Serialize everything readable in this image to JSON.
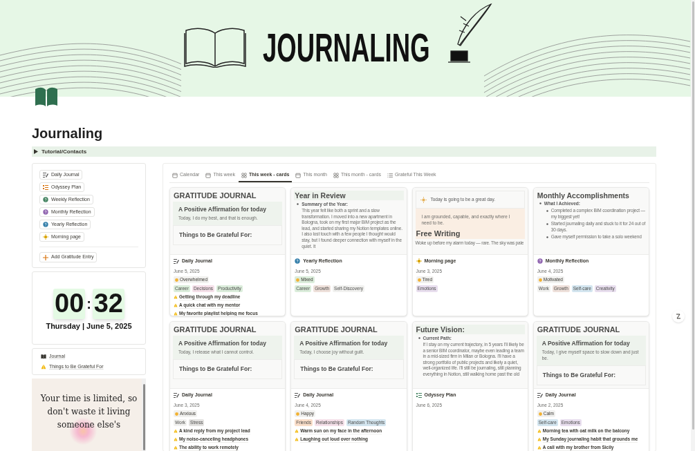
{
  "banner": {
    "title": "JOURNALING"
  },
  "page": {
    "title": "Journaling"
  },
  "toggle": {
    "label": "Tutorial/Contacts",
    "expanded": false
  },
  "buttons": [
    {
      "label": "Daily Journal",
      "kind": "journal",
      "color": "#555555"
    },
    {
      "label": "Odyssey Plan",
      "kind": "checklist",
      "color": "#d9730d"
    },
    {
      "label": "Weekly Reflection",
      "kind": "question",
      "color": "#448361"
    },
    {
      "label": "Monthly Reflection",
      "kind": "question",
      "color": "#9065b0"
    },
    {
      "label": "Yearly Reflection",
      "kind": "question",
      "color": "#337ea9"
    },
    {
      "label": "Morning page",
      "kind": "sun",
      "color": "#d9a400"
    }
  ],
  "add_button": {
    "label": "Add Gratitude Entry"
  },
  "clock": {
    "hours": "00",
    "separator": ":",
    "minutes": "32",
    "date": "Thursday | June 5, 2025"
  },
  "links": [
    {
      "label": "Journal",
      "kind": "book"
    },
    {
      "label": "Things to Be Grateful For",
      "kind": "hands"
    }
  ],
  "quote": {
    "text": "Your time is limited, so don't waste it living someone else's"
  },
  "tabs": [
    {
      "label": "Calendar",
      "kind": "calendar",
      "selected": false
    },
    {
      "label": "This week",
      "kind": "calendar",
      "selected": false
    },
    {
      "label": "This week - cards",
      "kind": "grid",
      "selected": true
    },
    {
      "label": "This month",
      "kind": "calendar",
      "selected": false
    },
    {
      "label": "This month - cards",
      "kind": "grid",
      "selected": false
    },
    {
      "label": "Grateful This Week",
      "kind": "list",
      "selected": false
    }
  ],
  "cards": [
    {
      "preview": {
        "kind": "gratitude",
        "heading": "GRATITUDE JOURNAL",
        "affirmation_title": "A Positive Affirmation for today",
        "affirmation": "Today, I do my best, and that is enough.",
        "grateful_title": "Things to Be Grateful For:"
      },
      "type": "Daily Journal",
      "kind": "journal",
      "color": "#555555",
      "date": "June 5, 2025",
      "mood": {
        "label": "Overwhelmed",
        "color": "#f1f1ef"
      },
      "tags": [
        {
          "label": "Career",
          "color": "#dbeddb"
        },
        {
          "label": "Decisions",
          "color": "#f5e0e9"
        },
        {
          "label": "Productivity",
          "color": "#dbeddb"
        }
      ],
      "gratitude": [
        "Getting through my deadline",
        "A quick chat with my mentor",
        "My favorite playlist helping me focus"
      ]
    },
    {
      "preview": {
        "kind": "review",
        "heading": "Year in Review",
        "bullet": "Summary of the Year:",
        "paragraph": "This year felt like both a sprint and a slow transformation. I moved into a new apartment in Bologna, took on my first major BIM project as the lead, and started sharing my Notion templates online. I also lost touch with a few people I thought would stay, but I found deeper connection with myself in the quiet. It"
      },
      "type": "Yearly Reflection",
      "kind": "question",
      "color": "#337ea9",
      "date": "June 5, 2025",
      "mood": {
        "label": "Mixed",
        "color": "#dbeddb"
      },
      "tags": [
        {
          "label": "Career",
          "color": "#dbeddb"
        },
        {
          "label": "Growth",
          "color": "#eee0da"
        },
        {
          "label": "Self-Discovery",
          "color": "#f1f1ef"
        }
      ]
    },
    {
      "preview": {
        "kind": "morning",
        "callout": "Today is going to be a great day.",
        "affirmation": "I am grounded, capable, and exactly where I need to be.",
        "heading": "Free Writing",
        "paragraph": "Woke up before my alarm today — rare. The sky was pale"
      },
      "type": "Morning page",
      "kind": "sun",
      "color": "#d9a400",
      "date": "June 3, 2025",
      "mood": {
        "label": "Tired",
        "color": "#f1f1ef"
      },
      "tags": [
        {
          "label": "Emotions",
          "color": "#e8deee"
        }
      ]
    },
    {
      "preview": {
        "kind": "list",
        "heading": "Monthly Accomplishments",
        "bullet": "What I Achieved:",
        "items": [
          "Completed a complex BIM coordination project — my biggest yet!",
          "Started journaling daily and stuck to it for 24 out of 30 days.",
          "Gave myself permission to take a solo weekend"
        ]
      },
      "type": "Monthly Reflection",
      "kind": "question",
      "color": "#9065b0",
      "date": "June 4, 2025",
      "mood": {
        "label": "Motivated",
        "color": "#f1f1ef"
      },
      "tags": [
        {
          "label": "Work",
          "color": "#f1f1ef"
        },
        {
          "label": "Growth",
          "color": "#eee0da"
        },
        {
          "label": "Self-care",
          "color": "#d3e5ef"
        },
        {
          "label": "Creativity",
          "color": "#e8deee"
        }
      ]
    },
    {
      "preview": {
        "kind": "gratitude",
        "heading": "GRATITUDE JOURNAL",
        "affirmation_title": "A Positive Affirmation for today",
        "affirmation": "Today, I release what I cannot control.",
        "grateful_title": "Things to Be Grateful For:"
      },
      "type": "Daily Journal",
      "kind": "journal",
      "color": "#555555",
      "date": "June 3, 2025",
      "mood": {
        "label": "Anxious",
        "color": "#f1f1ef"
      },
      "tags": [
        {
          "label": "Work",
          "color": "#f1f1ef"
        },
        {
          "label": "Stress",
          "color": "#e3e2e0"
        }
      ],
      "gratitude": [
        "A kind reply from my project lead",
        "My noise-canceling headphones",
        "The ability to work remotely"
      ]
    },
    {
      "preview": {
        "kind": "gratitude",
        "heading": "GRATITUDE JOURNAL",
        "affirmation_title": "A Positive Affirmation for today",
        "affirmation": "Today, I choose joy without guilt.",
        "grateful_title": "Things to Be Grateful For:"
      },
      "type": "Daily Journal",
      "kind": "journal",
      "color": "#555555",
      "date": "June 4, 2025",
      "mood": {
        "label": "Happy",
        "color": "#f1f1ef"
      },
      "tags": [
        {
          "label": "Friends",
          "color": "#fadec9"
        },
        {
          "label": "Relationships",
          "color": "#f5e0e9"
        },
        {
          "label": "Random Thoughts",
          "color": "#d3e5ef"
        }
      ],
      "gratitude": [
        "Warm sun on my face in the afternoon",
        "Laughing out loud over nothing"
      ]
    },
    {
      "preview": {
        "kind": "review",
        "heading": "Future Vision:",
        "bullet": "Current Path:",
        "paragraph": "If I stay on my current trajectory, in 5 years I'll likely be a senior BIM coordinator, maybe even leading a team in a mid-sized firm in Milan or Bologna. I'll have a strong portfolio of public projects and likely a quiet, well-organized life. I'll still be journaling, still planning everything in Notion, still walking home past the old"
      },
      "type": "Odyssey Plan",
      "kind": "checklist",
      "color": "#448361",
      "date": "June 6, 2025"
    },
    {
      "preview": {
        "kind": "gratitude",
        "heading": "GRATITUDE JOURNAL",
        "affirmation_title": "A Positive Affirmation for today",
        "affirmation": "Today, I give myself space to slow down and just be.",
        "grateful_title": "Things to Be Grateful For:"
      },
      "type": "Daily Journal",
      "kind": "journal",
      "color": "#555555",
      "date": "June 2, 2025",
      "mood": {
        "label": "Calm",
        "color": "#f1f1ef"
      },
      "tags": [
        {
          "label": "Self-care",
          "color": "#d3e5ef"
        },
        {
          "label": "Emotions",
          "color": "#e8deee"
        }
      ],
      "gratitude": [
        "Morning tea with oat milk on the balcony",
        "My Sunday journaling habit that grounds me",
        "A call with my brother from Sicily"
      ]
    }
  ]
}
